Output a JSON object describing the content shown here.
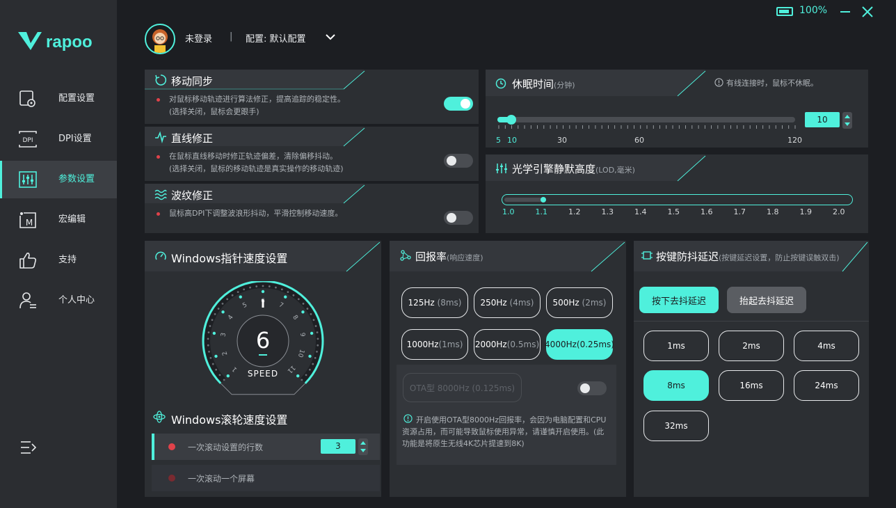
{
  "brand": {
    "logo_text": "rapoo"
  },
  "window": {
    "battery": "100%"
  },
  "header": {
    "user": "未登录",
    "separator": "|",
    "config": "配置: 默认配置"
  },
  "sidebar": {
    "items": [
      {
        "label": "配置设置",
        "icon": "config-icon"
      },
      {
        "label": "DPI设置",
        "icon": "dpi-icon",
        "icon_text": "DPI"
      },
      {
        "label": "参数设置",
        "icon": "sliders-icon",
        "active": true
      },
      {
        "label": "宏编辑",
        "icon": "macro-icon",
        "icon_text": "M"
      },
      {
        "label": "支持",
        "icon": "thumbs-up-icon"
      },
      {
        "label": "个人中心",
        "icon": "user-icon"
      }
    ]
  },
  "motion_sync": {
    "title": "移动同步",
    "desc1": "对鼠标移动轨迹进行算法修正，提高追踪的稳定性。",
    "desc2": "(选择关闭，鼠标会更跟手)",
    "enabled": true
  },
  "angle_snap": {
    "title": "直线修正",
    "desc1": "在鼠标直线移动时修正轨迹偏差，清除偏移抖动。",
    "desc2": "(选择关闭，鼠标的移动轨迹是真实操作的移动轨迹)",
    "enabled": false
  },
  "ripple": {
    "title": "波纹修正",
    "desc1": "鼠标高DPI下调整波浪形抖动，平滑控制移动速度。",
    "enabled": false
  },
  "sleep": {
    "title": "休眠时间",
    "unit": "(分钟)",
    "note": "有线连接时，鼠标不休眠。",
    "value": "10",
    "ticks": [
      "5",
      "10",
      "30",
      "60",
      "120"
    ],
    "min": 5,
    "max": 120,
    "current": 10
  },
  "lod": {
    "title": "光学引擎静默高度",
    "unit": "(LOD,毫米)",
    "ticks": [
      "1.0",
      "1.1",
      "1.2",
      "1.3",
      "1.4",
      "1.5",
      "1.6",
      "1.7",
      "1.8",
      "1.9",
      "2.0"
    ],
    "current": 1.1
  },
  "pointer_speed": {
    "title": "Windows指针速度设置",
    "value": "6",
    "label": "SPEED",
    "dial_numbers": [
      "1",
      "2",
      "3",
      "4",
      "5",
      "6",
      "7",
      "8",
      "9",
      "10",
      "11"
    ]
  },
  "scroll_speed": {
    "title": "Windows滚轮速度设置",
    "option1": "一次滚动设置的行数",
    "option1_value": "3",
    "option2": "一次滚动一个屏幕"
  },
  "polling": {
    "title": "回报率",
    "unit": "(响应速度)",
    "rates": [
      {
        "hz": "125Hz",
        "ms": "(8ms)"
      },
      {
        "hz": "250Hz",
        "ms": "(4ms)"
      },
      {
        "hz": "500Hz",
        "ms": "(2ms)"
      },
      {
        "hz": "1000Hz",
        "ms": "(1ms)"
      },
      {
        "hz": "2000Hz",
        "ms": "(0.5ms)"
      },
      {
        "hz": "4000Hz",
        "ms": "(0.25ms)",
        "selected": true
      }
    ],
    "ota_label": "OTA型 8000Hz (0.125ms)",
    "ota_enabled": false,
    "ota_note": "开启使用OTA型8000Hz回报率，会因为电脑配置和CPU资源占用，而可能导致鼠标使用异常，请谨慎开启使用。(此功能是将原生无线4K芯片提速到8K)"
  },
  "debounce": {
    "title": "按键防抖延迟",
    "unit": "(按键延迟设置，防止按键误触双击)",
    "tab_press": "按下去抖延迟",
    "tab_release": "抬起去抖延迟",
    "options": [
      "1ms",
      "2ms",
      "4ms",
      "8ms",
      "16ms",
      "24ms",
      "32ms"
    ],
    "selected": "8ms"
  },
  "colors": {
    "accent": "#4ff0dc",
    "panel": "#2c2f33",
    "sidebar": "#2b2d31",
    "alert": "#e0424a"
  }
}
